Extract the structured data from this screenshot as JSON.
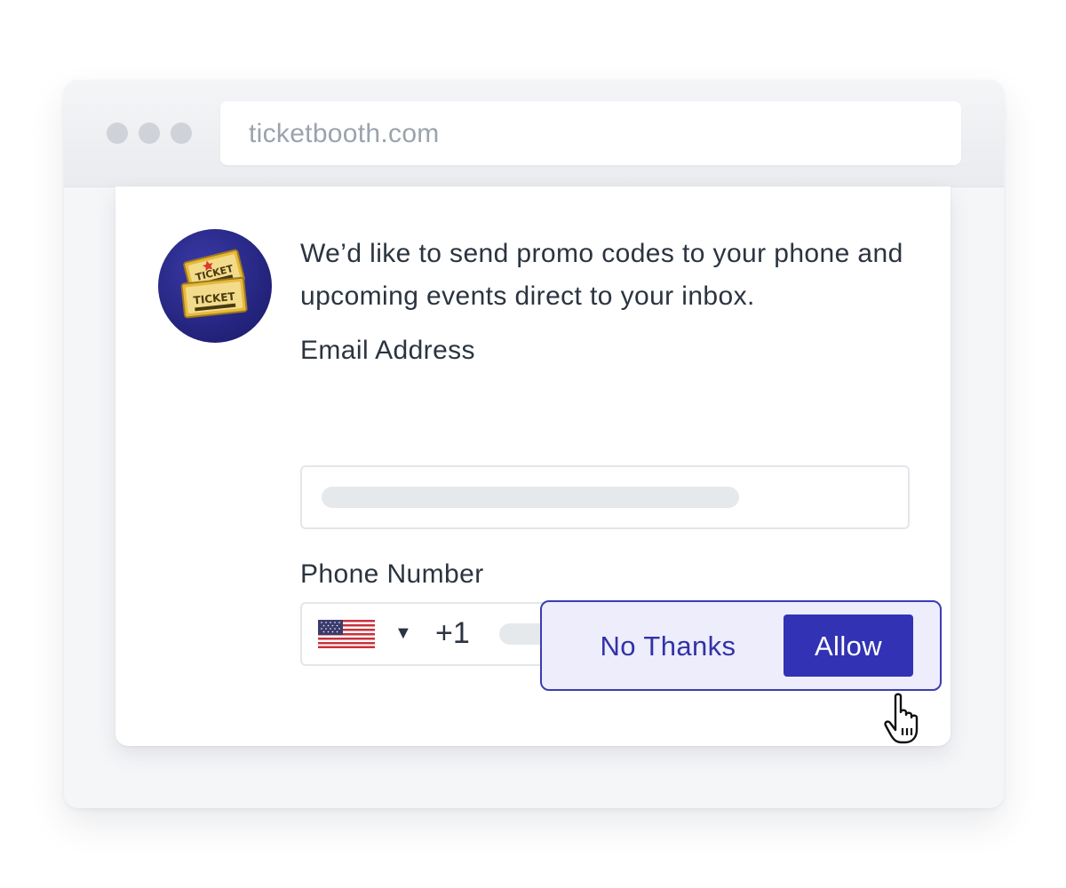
{
  "browser": {
    "url": "ticketbooth.com",
    "window_controls": [
      "window-dot",
      "window-dot",
      "window-dot"
    ]
  },
  "prompt": {
    "avatar_icon": "ticket-icon",
    "ticket_text": "TICKET",
    "message": "We’d like to send promo codes to your phone and upcoming events direct to your inbox.",
    "email": {
      "label": "Email Address",
      "value": ""
    },
    "phone": {
      "label": "Phone Number",
      "country_flag": "us-flag-icon",
      "dial_code": "+1",
      "value": ""
    },
    "buttons": {
      "decline": "No Thanks",
      "accept": "Allow"
    }
  },
  "colors": {
    "accent": "#3232b4",
    "action_bg": "#ededfb",
    "avatar_bg": "#22227a",
    "text": "#2b3440",
    "url_text": "#9aa3ad"
  },
  "cursor_icon": "hand-pointer-icon"
}
